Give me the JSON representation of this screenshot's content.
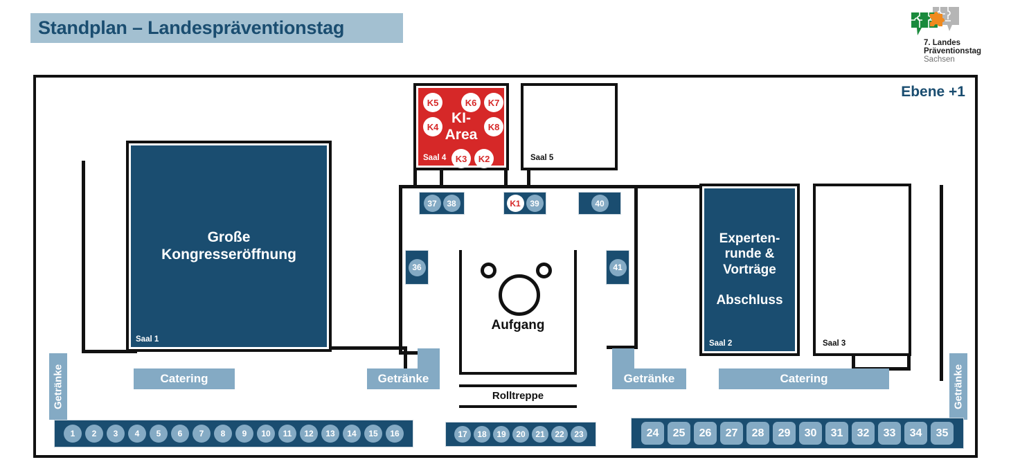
{
  "header": {
    "title": "Standplan – Landespräventionstag",
    "banner_color": "#a3c0d1",
    "title_color": "#1a4d70"
  },
  "logo": {
    "name": "landespraeventionstag-logo",
    "line1": "7. Landes",
    "line2": "Präventionstag",
    "line3": "Sachsen",
    "colors": {
      "green": "#1a8a3c",
      "grey": "#b5b5b5",
      "orange": "#f08a1e"
    }
  },
  "floor": {
    "level_label": "Ebene +1"
  },
  "rooms": [
    {
      "id": "saal1",
      "title_lines": [
        "Große",
        "Kongresseröffnung"
      ],
      "saal": "Saal 1",
      "fill": "blue"
    },
    {
      "id": "saal2",
      "title_lines": [
        "Experten-",
        "runde &",
        "Vorträge",
        "",
        "Abschluss"
      ],
      "saal": "Saal 2",
      "fill": "blue"
    },
    {
      "id": "saal3",
      "title_lines": [],
      "saal": "Saal 3",
      "fill": "white"
    },
    {
      "id": "saal4",
      "title_lines": [
        "KI-",
        "Area"
      ],
      "saal": "Saal 4",
      "fill": "red"
    },
    {
      "id": "saal5",
      "title_lines": [],
      "saal": "Saal 5",
      "fill": "white"
    }
  ],
  "ki_markers": [
    "K5",
    "K6",
    "K7",
    "K4",
    "K8",
    "K3",
    "K2"
  ],
  "ki_marker_k5": "K5",
  "ki_marker_k6": "K6",
  "ki_marker_k7": "K7",
  "ki_marker_k4": "K4",
  "ki_marker_k8": "K8",
  "ki_marker_k3": "K3",
  "ki_marker_k2": "K2",
  "booth_groups": {
    "row_left": {
      "booths": [
        "1",
        "2",
        "3",
        "4",
        "5",
        "6",
        "7",
        "8",
        "9",
        "10",
        "11",
        "12",
        "13",
        "14",
        "15",
        "16"
      ],
      "shape": "circle"
    },
    "row_center": {
      "booths": [
        "17",
        "18",
        "19",
        "20",
        "21",
        "22",
        "23"
      ],
      "shape": "circle"
    },
    "row_right": {
      "booths": [
        "24",
        "25",
        "26",
        "27",
        "28",
        "29",
        "30",
        "31",
        "32",
        "33",
        "34",
        "35"
      ],
      "shape": "square"
    },
    "block_3738": {
      "booths": [
        "37",
        "38"
      ],
      "shape": "circle"
    },
    "block_k139": {
      "booths": [
        "K1",
        "39"
      ],
      "shape": "circle"
    },
    "block_40": {
      "booths": [
        "40"
      ],
      "shape": "circle"
    },
    "block_36": {
      "booths": [
        "36"
      ],
      "shape": "circle"
    },
    "block_41": {
      "booths": [
        "41"
      ],
      "shape": "circle"
    }
  },
  "services": {
    "getraenke_far_left": "Getränke",
    "catering_left": "Catering",
    "getraenke_mid_left": "Getränke",
    "getraenke_mid_right": "Getränke",
    "catering_right": "Catering",
    "getraenke_far_right": "Getränke"
  },
  "stairs": {
    "aufgang": "Aufgang",
    "rolltreppe": "Rolltreppe"
  },
  "colors": {
    "dark_blue": "#1a4d70",
    "light_blue": "#84aac4",
    "banner_blue": "#a3c0d1",
    "red": "#d62828",
    "black": "#111111",
    "white": "#ffffff"
  }
}
